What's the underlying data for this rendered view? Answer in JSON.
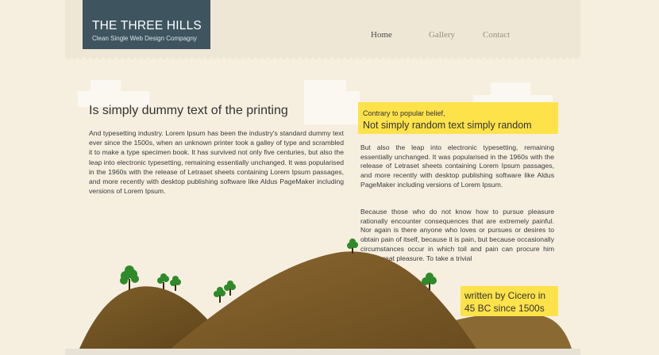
{
  "logo": {
    "title": "THE THREE HILLS",
    "tagline": "Clean Single Web Design Compagny"
  },
  "nav": {
    "items": [
      {
        "label": "Home",
        "active": true
      },
      {
        "label": "Gallery",
        "active": false
      },
      {
        "label": "Contact",
        "active": false
      }
    ]
  },
  "left": {
    "heading": "Is simply dummy text of the printing",
    "body": "And typesetting industry. Lorem Ipsum has been the industry's standard dummy text ever since the 1500s, when an unknown printer took a galley of type and scrambled it to make a type specimen book. It has survived not only five centuries, but also the  leap into electronic typesetting, remaining essentially unchanged. It was popularised in the 1960s with the release of Letraset sheets containing Lorem Ipsum passages, and more recently with desktop publishing software like Aldus PageMaker including versions of Lorem Ipsum."
  },
  "right": {
    "kicker": "Contrary to popular belief,",
    "heading": "Not simply random text simply random",
    "paragraph1": "But also the  leap into electronic typesetting, remaining essentially unchanged. It was popularised in the 1960s with the release of Letraset sheets containing Lorem Ipsum passages, and more recently with desktop publishing software like Aldus PageMaker including versions of Lorem Ipsum.",
    "paragraph2": "Because those who do not know how to pursue pleasure rationally encounter consequences that are extremely painful. Nor again is there anyone who loves or pursues or desires to obtain pain of itself, because it is pain, but because occasionally circumstances occur in which toil and pain can procure him some great pleasure. To take a trivial"
  },
  "signature": {
    "line1": "written by Cicero in",
    "line2": "45 BC since 1500s"
  },
  "colors": {
    "background": "#f6efe0",
    "logo_bg": "#3e5560",
    "highlight": "#fde24a",
    "hill": "#7a5a27",
    "tree": "#2f8a2a"
  }
}
